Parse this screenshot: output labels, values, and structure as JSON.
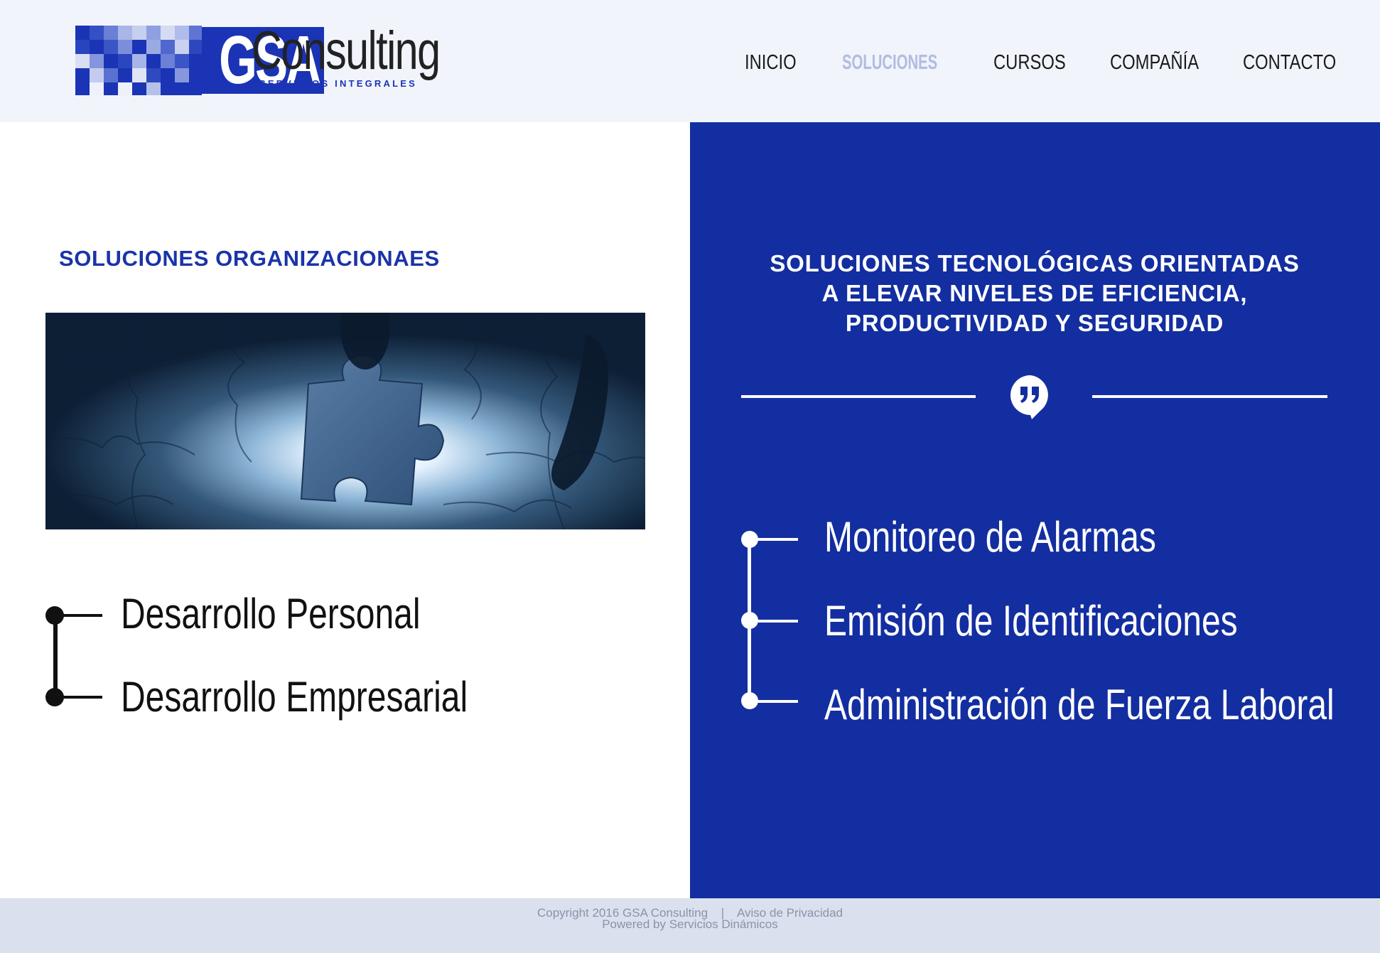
{
  "brand": {
    "logo_mark": "GSA",
    "logo_name": "Consulting",
    "logo_tagline": "SERVICIOS INTEGRALES",
    "accent_color": "#132ea0",
    "active_nav_color": "#b2bce0"
  },
  "nav": {
    "items": [
      {
        "label": "INICIO",
        "active": false
      },
      {
        "label": "SOLUCIONES",
        "active": true
      },
      {
        "label": "CURSOS",
        "active": false
      },
      {
        "label": "COMPAÑÍA",
        "active": false
      },
      {
        "label": "CONTACTO",
        "active": false
      }
    ]
  },
  "left": {
    "title": "SOLUCIONES ORGANIZACIONAES",
    "image_icon": "puzzle-piece-image",
    "items": [
      {
        "label": "Desarrollo Personal"
      },
      {
        "label": "Desarrollo Empresarial"
      }
    ]
  },
  "right": {
    "title_lines": [
      "SOLUCIONES TECNOLÓGICAS ORIENTADAS",
      "A ELEVAR NIVELES DE EFICIENCIA,",
      "PRODUCTIVIDAD Y SEGURIDAD"
    ],
    "divider_icon": "quote-bubble-icon",
    "items": [
      {
        "label": "Monitoreo de Alarmas"
      },
      {
        "label": "Emisión de Identificaciones"
      },
      {
        "label": "Administración de Fuerza Laboral"
      }
    ]
  },
  "footer": {
    "copyright": "Copyright 2016 GSA Consulting",
    "separator": "|",
    "privacy_link": "Aviso de Privacidad",
    "powered_by": "Powered by Servicios Dinámicos"
  }
}
